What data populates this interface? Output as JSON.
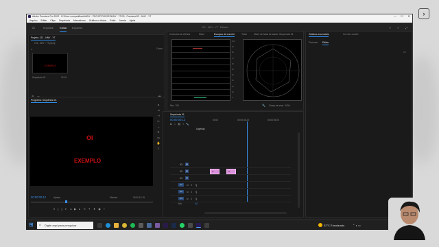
{
  "window": {
    "title": "Adobe Premiere Pro 2022 - D:\\Drive compartilhado\\NNY - PROJETOS\\2022\\NNY - YT\\03 - Premiere\\03 - NNY - YT",
    "minimize": "—",
    "maximize": "☐",
    "close": "✕"
  },
  "menu": [
    "Arquivo",
    "Editar",
    "Clipe",
    "Sequência",
    "Marcadores",
    "Gráficos e títulos",
    "Exibir",
    "Janela",
    "Ajuda"
  ],
  "workspace": {
    "tabs": [
      "Importar",
      "Editar",
      "Exportar"
    ],
    "active": "Editar",
    "project_name": "121 - NNY - YT  ·  Editado"
  },
  "project_panel": {
    "tab": "Projeto: 121 - NNY - YT",
    "path": "121 - NNY - YT.prproj",
    "item_count": "1 item",
    "clip_name": "Sequência 01",
    "clip_duration": "12:19",
    "thumb_text": "EXEMPLO"
  },
  "scopes": {
    "tabs": [
      "Controles de efeitos",
      "Mixer",
      "Escopos de Lumetri",
      "Texto",
      "Mixer de faixa de áudio: Sequência 01"
    ],
    "active": "Escopos de Lumetri",
    "left_footer": "Rec. 709",
    "right_footer": "Clamp de sinal  ·  8 Bit",
    "scale": [
      "100",
      "90",
      "80",
      "70",
      "60",
      "50",
      "40",
      "30",
      "20",
      "10",
      "0"
    ]
  },
  "program_monitor": {
    "tab": "Programa: Sequência 01",
    "line1": "OI",
    "line2": "EXEMPLO",
    "timecode": "00:00:00:12",
    "fit": "Ajustar",
    "quality": "Máxima",
    "duration": "00:00:12:19"
  },
  "timeline": {
    "tab": "Sequência 01",
    "timecode": "00:00:00:12",
    "ruler": [
      "00:00",
      "00:00:04:23",
      "00:00:09:23"
    ],
    "video_tracks": [
      "V3",
      "V2",
      "V1"
    ],
    "audio_tracks": [
      "A1",
      "A2",
      "A3"
    ],
    "mix_label": "Mix",
    "mix_value": "0,0",
    "clip_label": "fx",
    "subtitles_label": "Legenda"
  },
  "right_panel": {
    "tabs": [
      "Gráficos essenciais",
      "Cor de Lumetri"
    ],
    "subtabs": [
      "Procurar",
      "Editar"
    ],
    "active_subtab": "Editar"
  },
  "taskbar": {
    "search_placeholder": "Digite aqui para pesquisar",
    "weather": "32°C  Ensolarado",
    "time": "13:51",
    "date": "23/06/2022"
  },
  "colors": {
    "accent": "#2d8ceb",
    "timecode": "#3b8ee8",
    "title_red": "#d01010",
    "clip_pink": "#d98fd9"
  }
}
